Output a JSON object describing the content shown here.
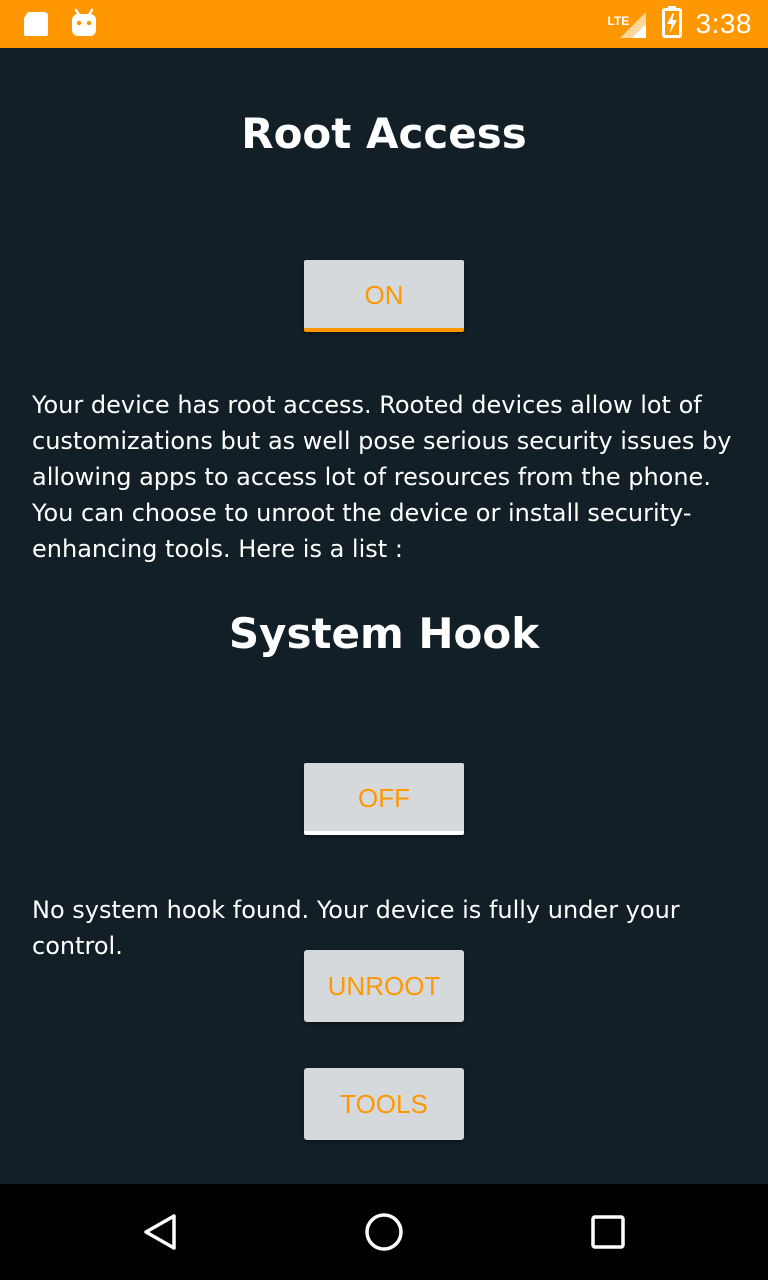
{
  "status_bar": {
    "time": "3:38",
    "network_label": "LTE",
    "bg_color": "#ff9800",
    "icons": [
      "sd-card-icon",
      "android-debug-icon",
      "lte-signal-icon",
      "battery-charging-icon"
    ]
  },
  "root_section": {
    "title": "Root Access",
    "toggle_label": "ON",
    "description": "Your device has root access. Rooted devices allow lot of customizations but as well pose serious security issues by allowing apps to access lot of resources from the phone. You can choose to unroot the device or install security-enhancing tools. Here is a list :"
  },
  "hook_section": {
    "title": "System Hook",
    "toggle_label": "OFF",
    "description": "No system hook found. Your device is fully under your control."
  },
  "actions": {
    "unroot_label": "UNROOT",
    "tools_label": "TOOLS"
  },
  "nav_bar": {
    "icons": [
      "back-icon",
      "home-icon",
      "recents-icon"
    ]
  },
  "colors": {
    "background": "#121f27",
    "accent": "#ff9800",
    "button_bg": "#d5d9dc",
    "text": "#ffffff"
  }
}
